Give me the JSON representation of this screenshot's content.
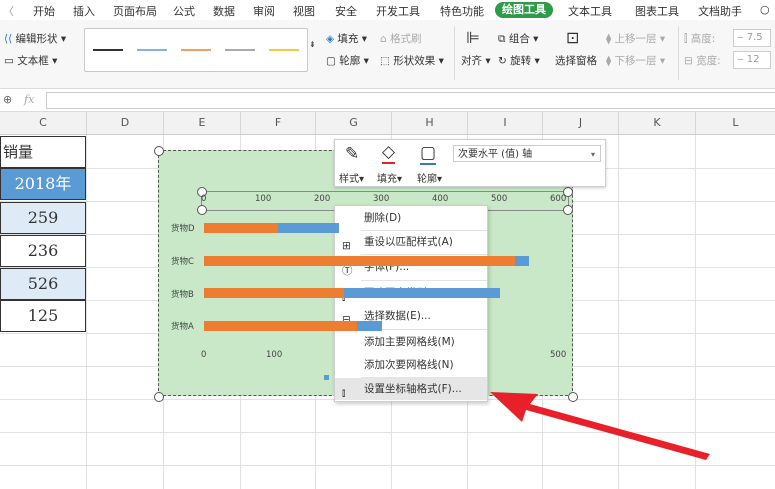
{
  "menu": {
    "items": [
      "开始",
      "插入",
      "页面布局",
      "公式",
      "数据",
      "审阅",
      "视图",
      "安全",
      "开发工具",
      "特色功能",
      "绘图工具",
      "文本工具",
      "图表工具",
      "文档助手"
    ],
    "active": "绘图工具"
  },
  "ribbon": {
    "edit_shape": "编辑形状",
    "textbox": "文本框",
    "fill": "填充",
    "outline": "轮廓",
    "format_brush": "格式刷",
    "shape_effects": "形状效果",
    "align": "对齐",
    "group": "组合",
    "rotate": "旋转",
    "selection_pane": "选择窗格",
    "bring_forward": "上移一层",
    "send_backward": "下移一层",
    "height_label": "高度:",
    "width_label": "宽度:",
    "height_value": "7.5",
    "width_value": "12",
    "line_colors": [
      "#333333",
      "#7fb6d9",
      "#f0a060",
      "#aaaaaa",
      "#f5c842"
    ]
  },
  "formula_bar": {
    "fx": "fx",
    "value": ""
  },
  "columns": [
    "C",
    "D",
    "E",
    "F",
    "G",
    "H",
    "I",
    "J",
    "K",
    "L"
  ],
  "table": {
    "header": "销量",
    "year": "2018年",
    "values": [
      "259",
      "236",
      "526",
      "125"
    ]
  },
  "chart_data": {
    "type": "bar",
    "categories": [
      "货物D",
      "货物C",
      "货物B",
      "货物A"
    ],
    "top_axis_ticks": [
      "0",
      "100",
      "200",
      "300",
      "400",
      "500",
      "600"
    ],
    "bottom_axis_ticks": [
      "0",
      "100",
      "500"
    ],
    "series": [
      {
        "color": "#ed7d31",
        "values": [
          125,
          526,
          236,
          259
        ]
      },
      {
        "color": "#5b9bd5",
        "values": [
          228,
          550,
          500,
          300
        ]
      }
    ],
    "xlim": [
      0,
      600
    ]
  },
  "float_toolbar": {
    "style": "样式",
    "fill": "填充",
    "outline": "轮廓",
    "axis_select": "次要水平 (值) 轴"
  },
  "context_menu": {
    "items": [
      "删除(D)",
      "重设以匹配样式(A)",
      "字体(F)...",
      "更改图表类型(Y)...",
      "选择数据(E)...",
      "添加主要网格线(M)",
      "添加次要网格线(N)",
      "设置坐标轴格式(F)..."
    ]
  },
  "colors": {
    "accent": "#2e9b47",
    "table_header": "#5b9bd5",
    "chart_bg": "#c9e8c8",
    "arrow": "#e8202a"
  }
}
